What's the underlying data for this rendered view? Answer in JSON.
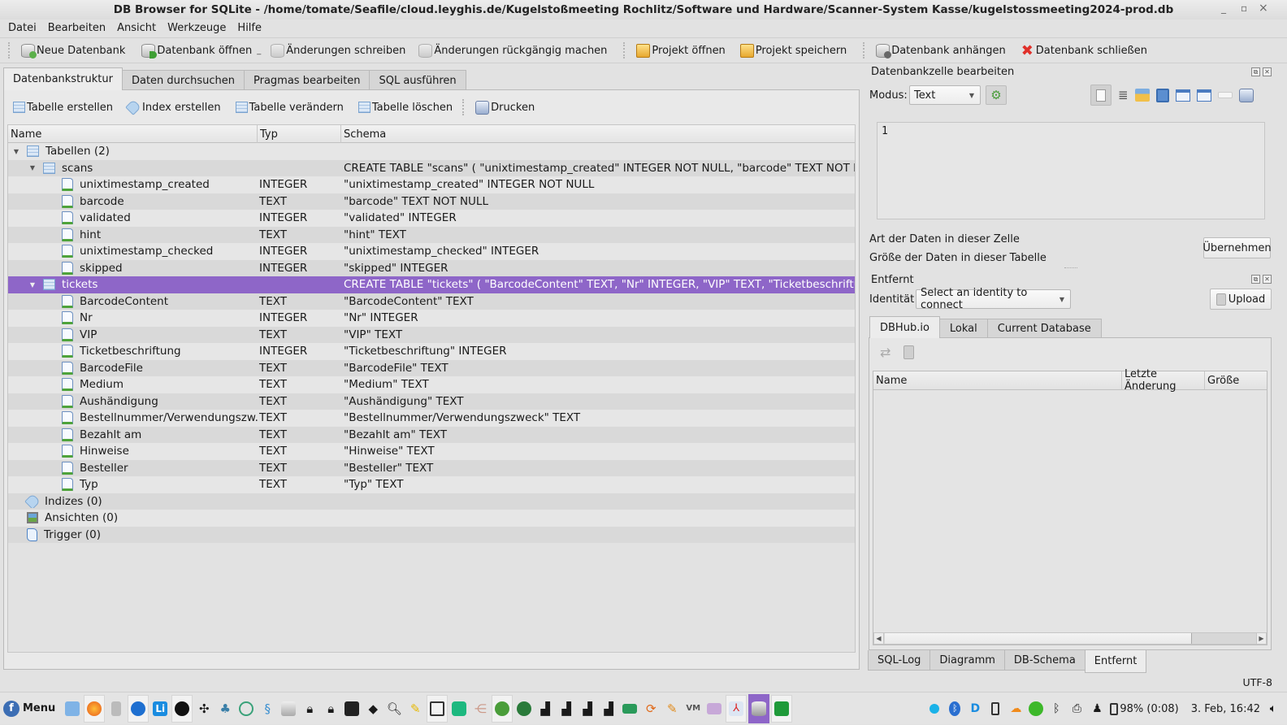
{
  "window": {
    "title": "DB Browser for SQLite - /home/tomate/Seafile/cloud.leyghis.de/Kugelstoßmeeting Rochlitz/Software und Hardware/Scanner-System Kasse/kugelstossmeeting2024-prod.db",
    "minimize": "_",
    "maximize": "▫",
    "close": "×"
  },
  "menu": [
    "Datei",
    "Bearbeiten",
    "Ansicht",
    "Werkzeuge",
    "Hilfe"
  ],
  "toolbar": {
    "new_db": "Neue Datenbank",
    "open_db": "Datenbank öffnen",
    "write_changes": "Änderungen schreiben",
    "revert_changes": "Änderungen rückgängig machen",
    "open_project": "Projekt öffnen",
    "save_project": "Projekt speichern",
    "attach_db": "Datenbank anhängen",
    "close_db": "Datenbank schließen"
  },
  "main_tabs": [
    "Datenbankstruktur",
    "Daten durchsuchen",
    "Pragmas bearbeiten",
    "SQL ausführen"
  ],
  "structure_toolbar": {
    "create_table": "Tabelle erstellen",
    "create_index": "Index erstellen",
    "modify_table": "Tabelle verändern",
    "delete_table": "Tabelle löschen",
    "print": "Drucken"
  },
  "tree": {
    "headers": [
      "Name",
      "Typ",
      "Schema"
    ],
    "rows": [
      {
        "level": 0,
        "kind": "group-tables",
        "expand": "▼",
        "name": "Tabellen (2)",
        "type": "",
        "schema": ""
      },
      {
        "level": 1,
        "kind": "table",
        "expand": "▼",
        "name": "scans",
        "type": "",
        "schema": "CREATE TABLE \"scans\" ( \"unixtimestamp_created\" INTEGER NOT NULL, \"barcode\" TEXT NOT NULL, \"validated\" INTEGER, \"hint\" TEXT, \"unixtimestamp_checked\" INTEGER, \"skipped\" INTEGER )"
      },
      {
        "level": 2,
        "kind": "field",
        "name": "unixtimestamp_created",
        "type": "INTEGER",
        "schema": "\"unixtimestamp_created\" INTEGER NOT NULL"
      },
      {
        "level": 2,
        "kind": "field",
        "name": "barcode",
        "type": "TEXT",
        "schema": "\"barcode\" TEXT NOT NULL"
      },
      {
        "level": 2,
        "kind": "field",
        "name": "validated",
        "type": "INTEGER",
        "schema": "\"validated\" INTEGER"
      },
      {
        "level": 2,
        "kind": "field",
        "name": "hint",
        "type": "TEXT",
        "schema": "\"hint\" TEXT"
      },
      {
        "level": 2,
        "kind": "field",
        "name": "unixtimestamp_checked",
        "type": "INTEGER",
        "schema": "\"unixtimestamp_checked\" INTEGER"
      },
      {
        "level": 2,
        "kind": "field",
        "name": "skipped",
        "type": "INTEGER",
        "schema": "\"skipped\" INTEGER"
      },
      {
        "level": 1,
        "kind": "table",
        "expand": "▼",
        "name": "tickets",
        "type": "",
        "schema": "CREATE TABLE \"tickets\" ( \"BarcodeContent\" TEXT, \"Nr\" INTEGER, \"VIP\" TEXT, \"Ticketbeschriftung\" INTEGER, \"BarcodeFile\" TEXT, \"Medium\" TEXT",
        "selected": true
      },
      {
        "level": 2,
        "kind": "field",
        "name": "BarcodeContent",
        "type": "TEXT",
        "schema": "\"BarcodeContent\" TEXT"
      },
      {
        "level": 2,
        "kind": "field",
        "name": "Nr",
        "type": "INTEGER",
        "schema": "\"Nr\" INTEGER"
      },
      {
        "level": 2,
        "kind": "field",
        "name": "VIP",
        "type": "TEXT",
        "schema": "\"VIP\" TEXT"
      },
      {
        "level": 2,
        "kind": "field",
        "name": "Ticketbeschriftung",
        "type": "INTEGER",
        "schema": "\"Ticketbeschriftung\" INTEGER"
      },
      {
        "level": 2,
        "kind": "field",
        "name": "BarcodeFile",
        "type": "TEXT",
        "schema": "\"BarcodeFile\" TEXT"
      },
      {
        "level": 2,
        "kind": "field",
        "name": "Medium",
        "type": "TEXT",
        "schema": "\"Medium\" TEXT"
      },
      {
        "level": 2,
        "kind": "field",
        "name": "Aushändigung",
        "type": "TEXT",
        "schema": "\"Aushändigung\" TEXT"
      },
      {
        "level": 2,
        "kind": "field",
        "name": "Bestellnummer/Verwendungszw...",
        "type": "TEXT",
        "schema": "\"Bestellnummer/Verwendungszweck\" TEXT"
      },
      {
        "level": 2,
        "kind": "field",
        "name": "Bezahlt am",
        "type": "TEXT",
        "schema": "\"Bezahlt am\" TEXT"
      },
      {
        "level": 2,
        "kind": "field",
        "name": "Hinweise",
        "type": "TEXT",
        "schema": "\"Hinweise\" TEXT"
      },
      {
        "level": 2,
        "kind": "field",
        "name": "Besteller",
        "type": "TEXT",
        "schema": "\"Besteller\" TEXT"
      },
      {
        "level": 2,
        "kind": "field",
        "name": "Typ",
        "type": "TEXT",
        "schema": "\"Typ\" TEXT"
      },
      {
        "level": 0,
        "kind": "group-indices",
        "name": "Indizes (0)",
        "type": "",
        "schema": ""
      },
      {
        "level": 0,
        "kind": "group-views",
        "name": "Ansichten (0)",
        "type": "",
        "schema": ""
      },
      {
        "level": 0,
        "kind": "group-triggers",
        "name": "Trigger (0)",
        "type": "",
        "schema": ""
      }
    ]
  },
  "cell_editor": {
    "title": "Datenbankzelle bearbeiten",
    "mode_label": "Modus:",
    "mode_value": "Text",
    "content": "1",
    "data_type_label": "Art der Daten in dieser Zelle",
    "data_size_label": "Größe der Daten in dieser Tabelle",
    "apply_button": "Übernehmen"
  },
  "remote": {
    "title": "Entfernt",
    "identity_label": "Identität",
    "identity_value": "Select an identity to connect",
    "upload_button": "Upload",
    "tabs": [
      "DBHub.io",
      "Lokal",
      "Current Database"
    ],
    "columns": [
      "Name",
      "Letzte Änderung",
      "Größe"
    ]
  },
  "bottom_tabs": [
    "SQL-Log",
    "Diagramm",
    "DB-Schema",
    "Entfernt"
  ],
  "statusbar": {
    "encoding": "UTF-8"
  },
  "taskbar": {
    "menu_label": "Menu",
    "battery": "98% (0:08)",
    "clock": "3. Feb, 16:42"
  },
  "colors": {
    "selection": "#8e66c8",
    "close_red": "#e0302a"
  }
}
